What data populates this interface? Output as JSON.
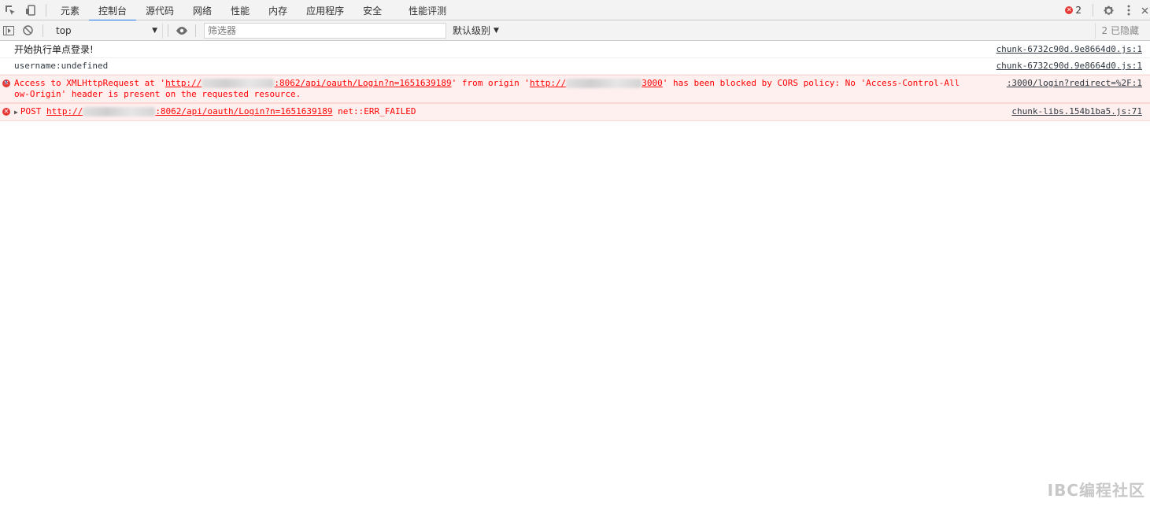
{
  "tabbar": {
    "tabs": [
      {
        "label": "元素"
      },
      {
        "label": "控制台"
      },
      {
        "label": "源代码"
      },
      {
        "label": "网络"
      },
      {
        "label": "性能"
      },
      {
        "label": "内存"
      },
      {
        "label": "应用程序"
      },
      {
        "label": "安全"
      },
      {
        "label": "性能评测"
      }
    ],
    "active_tab": "控制台",
    "error_count": "2"
  },
  "toolbar": {
    "context": "top",
    "filter_placeholder": "筛选器",
    "levels_label": "默认级别",
    "hidden_count": "2 已隐藏"
  },
  "messages": [
    {
      "text": "开始执行单点登录!",
      "source": "chunk-6732c90d.9e8664d0.js:1"
    },
    {
      "text": "username:undefined",
      "source": "chunk-6732c90d.9e8664d0.js:1"
    },
    {
      "level": "error",
      "part1": "Access to XMLHttpRequest at '",
      "url1a": "http://",
      "url1b": ":8062/api/oauth/Login?n=1651639189",
      "part2": "' from origin '",
      "url2a": "http://",
      "url2b": "3000",
      "part3": "' has been blocked by CORS policy: No 'Access-Control-Allow-Origin' header is present on the requested resource.",
      "source": ":3000/login?redirect=%2F:1"
    },
    {
      "level": "error",
      "method": "POST",
      "urla": "http://",
      "urlb": ":8062/api/oauth/Login?n=1651639189",
      "status": "net::ERR_FAILED",
      "source": "chunk-libs.154b1ba5.js:71"
    }
  ],
  "watermark": "IBC编程社区",
  "colors": {
    "accent": "#1a73e8",
    "error": "#ff0000",
    "error_bg": "#fff0f0"
  }
}
